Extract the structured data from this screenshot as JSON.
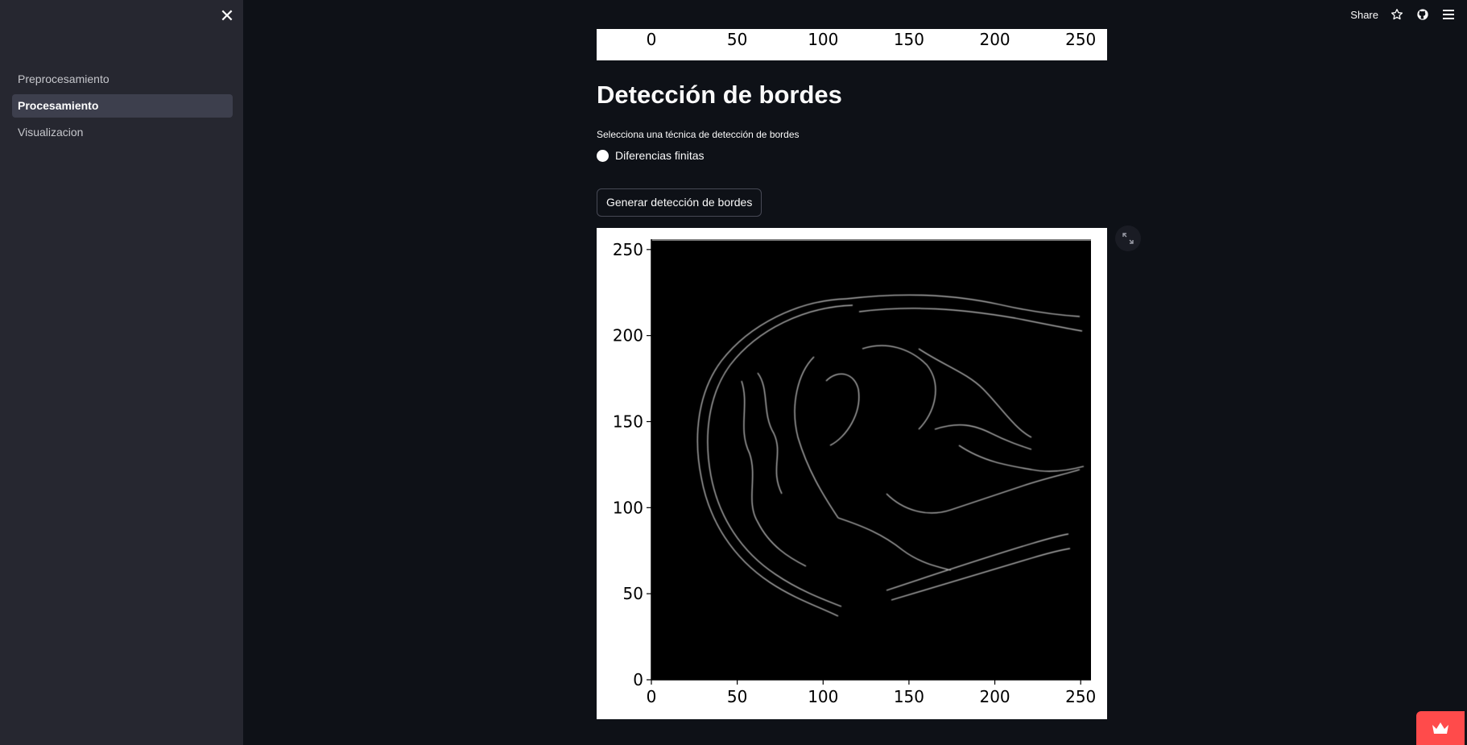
{
  "sidebar": {
    "close_icon": "close-icon",
    "items": [
      {
        "label": "Preprocesamiento",
        "active": false
      },
      {
        "label": "Procesamiento",
        "active": true
      },
      {
        "label": "Visualizacion",
        "active": false
      }
    ]
  },
  "toolbar": {
    "share_label": "Share",
    "icons": [
      "star-icon",
      "github-icon",
      "menu-icon"
    ]
  },
  "main": {
    "heading": "Detección de bordes",
    "radio_group_label": "Selecciona una técnica de detección de bordes",
    "radio_option": "Diferencias finitas",
    "generate_button": "Generar detección de bordes"
  },
  "colors": {
    "background": "#0e1117",
    "sidebar": "#262730",
    "accent": "#ff4b4b"
  },
  "chart_data": [
    {
      "type": "image",
      "x_ticks": [
        "0",
        "50",
        "100",
        "150",
        "200",
        "250"
      ]
    },
    {
      "type": "image",
      "x_ticks": [
        "0",
        "50",
        "100",
        "150",
        "200",
        "250"
      ],
      "y_ticks": [
        "0",
        "50",
        "100",
        "150",
        "200",
        "250"
      ],
      "xlim": [
        0,
        256
      ],
      "ylim": [
        0,
        256
      ]
    }
  ]
}
